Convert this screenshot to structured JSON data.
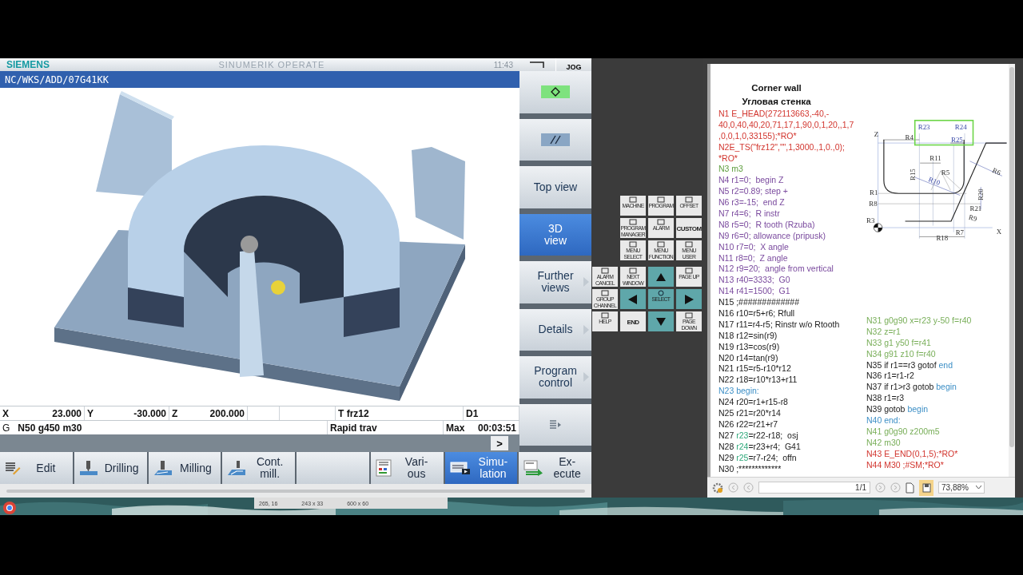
{
  "header": {
    "brand": "SIEMENS",
    "product": "SINUMERIK OPERATE",
    "time": "11:43",
    "mode": "JOG"
  },
  "path": "NC/WKS/ADD/07G41KK",
  "axes": [
    {
      "axis": "X",
      "value": "23.000"
    },
    {
      "axis": "Y",
      "value": "-30.000"
    },
    {
      "axis": "Z",
      "value": "200.000"
    }
  ],
  "tool": "T frz12",
  "offset": "D1",
  "g_label": "G",
  "g_codes": "N50 g450 m30",
  "feed": "Rapid trav",
  "time_label": "Max",
  "time": "00:03:51",
  "more": ">",
  "vertical_softkeys": [
    {
      "kind": "diamond",
      "selected": false,
      "arrow": false
    },
    {
      "kind": "slashes",
      "selected": false,
      "arrow": false
    },
    {
      "kind": "text",
      "lines": [
        "Top view"
      ],
      "selected": false,
      "arrow": false
    },
    {
      "kind": "text",
      "lines": [
        "3D",
        "view"
      ],
      "selected": true,
      "arrow": false
    },
    {
      "kind": "text",
      "lines": [
        "Further",
        "views"
      ],
      "selected": false,
      "arrow": true
    },
    {
      "kind": "text",
      "lines": [
        "Details"
      ],
      "selected": false,
      "arrow": true
    },
    {
      "kind": "text",
      "lines": [
        "Program",
        "control"
      ],
      "selected": false,
      "arrow": true
    },
    {
      "kind": "list",
      "selected": false,
      "arrow": false
    }
  ],
  "softkeys": [
    {
      "kind": "label",
      "lines": [
        "Edit"
      ],
      "selected": false
    },
    {
      "kind": "label",
      "lines": [
        "Drilling"
      ],
      "selected": false
    },
    {
      "kind": "label",
      "lines": [
        "Milling"
      ],
      "selected": false
    },
    {
      "kind": "label",
      "lines": [
        "Cont.",
        "mill."
      ],
      "selected": false
    },
    {
      "kind": "blank",
      "selected": false
    },
    {
      "kind": "label",
      "lines": [
        "Vari-",
        "ous"
      ],
      "selected": false
    },
    {
      "kind": "label",
      "lines": [
        "Simu-",
        "lation"
      ],
      "selected": true
    },
    {
      "kind": "label",
      "lines": [
        "Ex-",
        "ecute"
      ],
      "selected": false
    }
  ],
  "keypad_upper": [
    {
      "kind": "key",
      "label": "MACHINE"
    },
    {
      "kind": "key",
      "label": "PROGRAM"
    },
    {
      "kind": "key",
      "label": "OFFSET"
    },
    {
      "kind": "key",
      "label": "PROGRAM MANAGER"
    },
    {
      "kind": "key",
      "label": "ALARM"
    },
    {
      "kind": "text",
      "label": "CUSTOM"
    },
    {
      "kind": "key",
      "label": "MENU SELECT"
    },
    {
      "kind": "key",
      "label": "MENU FUNCTION"
    },
    {
      "kind": "key",
      "label": "MENU USER"
    }
  ],
  "keypad_side": [
    {
      "kind": "key",
      "label": "ALARM CANCEL"
    },
    {
      "kind": "key",
      "label": "GROUP CHANNEL"
    },
    {
      "kind": "key",
      "label": "HELP"
    }
  ],
  "keypad_lower": [
    {
      "kind": "key",
      "label": "NEXT WINDOW"
    },
    {
      "kind": "up"
    },
    {
      "kind": "key",
      "label": "PAGE UP"
    },
    {
      "kind": "left"
    },
    {
      "kind": "select",
      "label": "SELECT"
    },
    {
      "kind": "right"
    },
    {
      "kind": "text",
      "label": "END"
    },
    {
      "kind": "down"
    },
    {
      "kind": "key",
      "label": "PAGE DOWN"
    }
  ],
  "document": {
    "title": "Corner wall",
    "subtitle": "Угловая стенка",
    "left_lines": [
      {
        "parts": [
          {
            "text": "N1 E_HEAD(272113663,-40,-",
            "color": "#d2352e"
          }
        ]
      },
      {
        "parts": [
          {
            "text": "40,0,40,40,20,71,17,1,90,0,1,20,,1,7",
            "color": "#d2352e"
          }
        ]
      },
      {
        "parts": [
          {
            "text": ",0,0,1,0,33155);*RO*",
            "color": "#d2352e"
          }
        ]
      },
      {
        "parts": [
          {
            "text": "N2E_TS(\"frz12\",\"\",1,3000.,1,0.,0);",
            "color": "#d2352e"
          }
        ]
      },
      {
        "parts": [
          {
            "text": "*RO*",
            "color": "#d2352e"
          }
        ]
      },
      {
        "parts": [
          {
            "text": "N3 m3",
            "color": "#5e9e3e"
          }
        ]
      },
      {
        "parts": [
          {
            "text": "N4 r1=0;  begin Z",
            "color": "#7a4a9e"
          }
        ]
      },
      {
        "parts": [
          {
            "text": "N5 r2=0.89; step +",
            "color": "#7a4a9e"
          }
        ]
      },
      {
        "parts": [
          {
            "text": "N6 r3=-15;  end Z",
            "color": "#7a4a9e"
          }
        ]
      },
      {
        "parts": [
          {
            "text": "N7 r4=6;  R instr",
            "color": "#7a4a9e"
          }
        ]
      },
      {
        "parts": [
          {
            "text": "N8 r5=0;  R tooth (Rzuba)",
            "color": "#7a4a9e"
          }
        ]
      },
      {
        "parts": [
          {
            "text": "N9 r6=0; allowance (pripusk)",
            "color": "#7a4a9e"
          }
        ]
      },
      {
        "parts": [
          {
            "text": "N10 r7=0;  X angle",
            "color": "#7a4a9e"
          }
        ]
      },
      {
        "parts": [
          {
            "text": "N11 r8=0;  Z angle",
            "color": "#7a4a9e"
          }
        ]
      },
      {
        "parts": [
          {
            "text": "N12 r9=20;  angle from vertical",
            "color": "#7a4a9e"
          }
        ]
      },
      {
        "parts": [
          {
            "text": "N13 r40=3333;  G0",
            "color": "#7a4a9e"
          }
        ]
      },
      {
        "parts": [
          {
            "text": "N14 r41=1500;  G1",
            "color": "#7a4a9e"
          }
        ]
      },
      {
        "parts": [
          {
            "text": "N15 ;#############"
          }
        ]
      },
      {
        "parts": [
          {
            "text": "N16 r10=r5+r6; Rfull"
          }
        ]
      },
      {
        "parts": [
          {
            "text": "N17 r11=r4-r5; Rinstr w/o Rtooth"
          }
        ]
      },
      {
        "parts": [
          {
            "text": "N18 r12=sin(r9)"
          }
        ]
      },
      {
        "parts": [
          {
            "text": "N19 r13=cos(r9)"
          }
        ]
      },
      {
        "parts": [
          {
            "text": "N20 r14=tan(r9)"
          }
        ]
      },
      {
        "parts": [
          {
            "text": "N21 r15=r5-r10*r12"
          }
        ]
      },
      {
        "parts": [
          {
            "text": "N22 r18=r10*r13+r11"
          }
        ]
      },
      {
        "parts": [
          {
            "text": "N23 begin:",
            "color": "#3d8fc6"
          }
        ]
      },
      {
        "parts": [
          {
            "text": "N24 r20=r1+r15-r8"
          }
        ]
      },
      {
        "parts": [
          {
            "text": "N25 r21=r20*r14"
          }
        ]
      },
      {
        "parts": [
          {
            "text": "N26 r22=r21+r7"
          }
        ]
      },
      {
        "parts": [
          {
            "text": "N27 "
          },
          {
            "text": "r23",
            "color": "#2ea87a"
          },
          {
            "text": "=r22-r18;  osj"
          }
        ]
      },
      {
        "parts": [
          {
            "text": "N28 "
          },
          {
            "text": "r24",
            "color": "#2ea87a"
          },
          {
            "text": "=r23+r4;  G41"
          }
        ]
      },
      {
        "parts": [
          {
            "text": "N29 "
          },
          {
            "text": "r25",
            "color": "#2ea87a"
          },
          {
            "text": "=r7-r24;  offn"
          }
        ]
      },
      {
        "parts": [
          {
            "text": "N30 ;*************"
          }
        ]
      }
    ],
    "right_lines": [
      {
        "parts": [
          {
            "text": "N31 g0g90 x=r23 y-50 f=r40",
            "color": "#78ae58"
          }
        ]
      },
      {
        "parts": [
          {
            "text": "N32 z=r1",
            "color": "#78ae58"
          }
        ]
      },
      {
        "parts": [
          {
            "text": "N33 g1 y50 f=r41",
            "color": "#78ae58"
          }
        ]
      },
      {
        "parts": [
          {
            "text": "N34 g91 z10 f=r40",
            "color": "#78ae58"
          }
        ]
      },
      {
        "parts": [
          {
            "text": "N35 if r1==r3 gotof "
          },
          {
            "text": "end",
            "color": "#3d8fc6"
          }
        ]
      },
      {
        "parts": [
          {
            "text": "N36 r1=r1-r2"
          }
        ]
      },
      {
        "parts": [
          {
            "text": "N37 if r1>r3 gotob "
          },
          {
            "text": "begin",
            "color": "#3d8fc6"
          }
        ]
      },
      {
        "parts": [
          {
            "text": "N38 r1=r3"
          }
        ]
      },
      {
        "parts": [
          {
            "text": "N39 gotob "
          },
          {
            "text": "begin",
            "color": "#3d8fc6"
          }
        ]
      },
      {
        "parts": [
          {
            "text": "N40 end:",
            "color": "#3d8fc6"
          }
        ]
      },
      {
        "parts": [
          {
            "text": "N41 g0g90 z200m5",
            "color": "#78ae58"
          }
        ]
      },
      {
        "parts": [
          {
            "text": "N42 m30",
            "color": "#78ae58"
          }
        ]
      },
      {
        "parts": [
          {
            "text": "N43 E_END(0,1,5);*RO*",
            "color": "#d2352e"
          }
        ]
      },
      {
        "parts": [
          {
            "text": "N44 M30 ;#SM;*RO*",
            "color": "#d2352e"
          }
        ]
      }
    ],
    "diagram_labels": [
      {
        "text": "R23",
        "kind": "variable"
      },
      {
        "text": "R24",
        "kind": "variable"
      },
      {
        "text": "Z",
        "kind": "dimension"
      },
      {
        "text": "R4",
        "kind": "dimension"
      },
      {
        "text": "R25",
        "kind": "variable"
      },
      {
        "text": "R11",
        "kind": "dimension"
      },
      {
        "text": "R5",
        "kind": "dimension"
      },
      {
        "text": "R15",
        "kind": "dimension"
      },
      {
        "text": "R10",
        "kind": "variable"
      },
      {
        "text": "R6",
        "kind": "dimension"
      },
      {
        "text": "R1",
        "kind": "dimension"
      },
      {
        "text": "R20",
        "kind": "dimension"
      },
      {
        "text": "R8",
        "kind": "dimension"
      },
      {
        "text": "R21",
        "kind": "dimension"
      },
      {
        "text": "R9",
        "kind": "dimension"
      },
      {
        "text": "R3",
        "kind": "dimension"
      },
      {
        "text": "R7",
        "kind": "dimension"
      },
      {
        "text": "X",
        "kind": "dimension"
      },
      {
        "text": "R18",
        "kind": "dimension"
      }
    ]
  },
  "viewer": {
    "page": "1/1",
    "zoom": "73,88%"
  },
  "taskbar": {
    "cursor": "265, 16",
    "selection": "243 x 33",
    "canvas": "600 x 60"
  }
}
